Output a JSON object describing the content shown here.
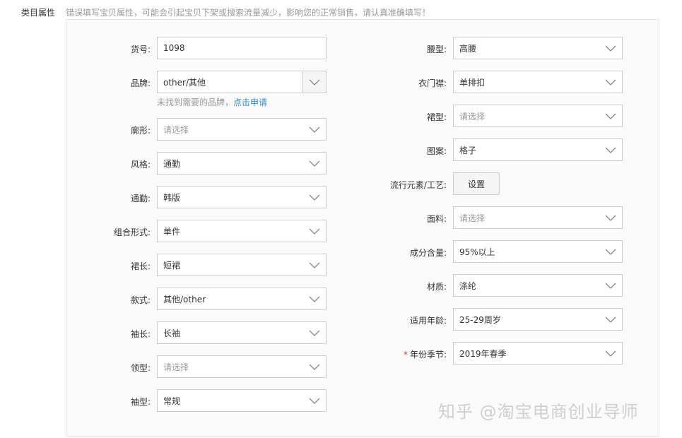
{
  "header": {
    "section_label": "类目属性",
    "warning": "错误填写宝贝属性，可能会引起宝贝下架或搜索流量减少，影响您的正常销售，请认真准确填写！"
  },
  "left": [
    {
      "label": "货号:",
      "kind": "input",
      "value": "1098"
    },
    {
      "label": "品牌:",
      "kind": "brand",
      "value": "other/其他"
    },
    {
      "label": "廓形:",
      "kind": "select",
      "value": "请选择",
      "placeholder": true
    },
    {
      "label": "风格:",
      "kind": "select",
      "value": "通勤"
    },
    {
      "label": "通勤:",
      "kind": "select",
      "value": "韩版"
    },
    {
      "label": "组合形式:",
      "kind": "select",
      "value": "单件"
    },
    {
      "label": "裙长:",
      "kind": "select",
      "value": "短裙"
    },
    {
      "label": "款式:",
      "kind": "select",
      "value": "其他/other"
    },
    {
      "label": "袖长:",
      "kind": "select",
      "value": "长袖"
    },
    {
      "label": "领型:",
      "kind": "select",
      "value": "请选择",
      "placeholder": true
    },
    {
      "label": "袖型:",
      "kind": "select",
      "value": "常规"
    }
  ],
  "brand_hint": {
    "text": "未找到需要的品牌，",
    "link": "点击申请"
  },
  "right": [
    {
      "label": "腰型:",
      "kind": "select",
      "value": "高腰"
    },
    {
      "label": "衣门襟:",
      "kind": "select",
      "value": "单排扣"
    },
    {
      "label": "裙型:",
      "kind": "select",
      "value": "请选择",
      "placeholder": true
    },
    {
      "label": "图案:",
      "kind": "select",
      "value": "格子"
    },
    {
      "label": "流行元素/工艺:",
      "kind": "button",
      "value": "设置"
    },
    {
      "label": "面料:",
      "kind": "select",
      "value": "请选择",
      "placeholder": true
    },
    {
      "label": "成分含量:",
      "kind": "select",
      "value": "95%以上"
    },
    {
      "label": "材质:",
      "kind": "select",
      "value": "涤纶"
    },
    {
      "label": "适用年龄:",
      "kind": "select",
      "value": "25-29周岁"
    },
    {
      "label": "年份季节:",
      "kind": "select",
      "value": "2019年春季",
      "required": true
    }
  ],
  "required_mark": "*",
  "watermark": "知乎 @淘宝电商创业导师",
  "colors": {
    "link": "#3089dc",
    "placeholder": "#999999",
    "required": "#ee3333"
  }
}
